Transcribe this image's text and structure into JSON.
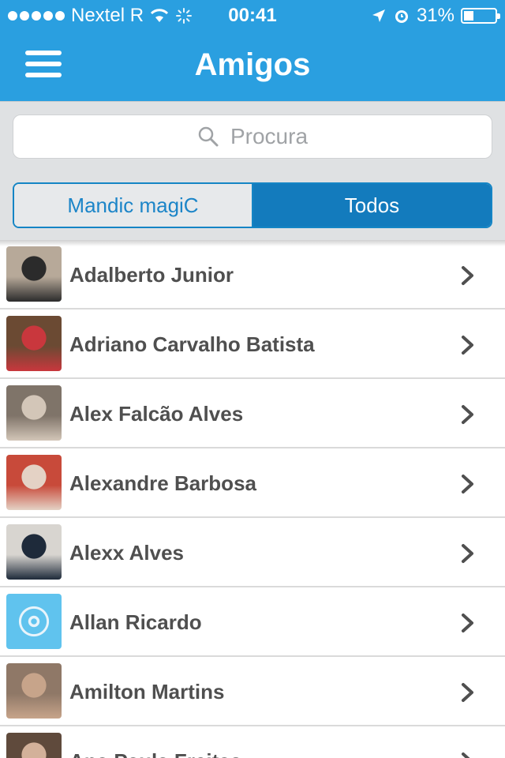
{
  "status_bar": {
    "carrier": "Nextel R",
    "time": "00:41",
    "battery_text": "31%",
    "battery_level": 0.31
  },
  "header": {
    "title": "Amigos",
    "menu_icon": "hamburger-menu-icon"
  },
  "search": {
    "placeholder": "Procura",
    "icon": "search-icon"
  },
  "segments": [
    {
      "label": "Mandic magiC",
      "selected": false
    },
    {
      "label": "Todos",
      "selected": true
    }
  ],
  "friends": [
    {
      "name": "Adalberto Junior",
      "avatar_colors": [
        "#b7a999",
        "#2b2b2b"
      ]
    },
    {
      "name": "Adriano Carvalho Batista",
      "avatar_colors": [
        "#6b4a33",
        "#c9373d"
      ]
    },
    {
      "name": "Alex Falcão Alves",
      "avatar_colors": [
        "#7f7469",
        "#d3c6b8"
      ]
    },
    {
      "name": "Alexandre Barbosa",
      "avatar_colors": [
        "#c84a3a",
        "#e4d2c5"
      ]
    },
    {
      "name": "Alexx Alves",
      "avatar_colors": [
        "#d8d5d0",
        "#1e2a3a"
      ]
    },
    {
      "name": "Allan Ricardo",
      "avatar_colors": [
        "#60c3ee",
        "#e8f4fb"
      ]
    },
    {
      "name": "Amilton Martins",
      "avatar_colors": [
        "#8f7867",
        "#c7a48a"
      ]
    },
    {
      "name": "Ana Paula Freitas",
      "avatar_colors": [
        "#5f4a3c",
        "#d3b19a"
      ]
    }
  ],
  "colors": {
    "accent": "#2a9fe0",
    "segment_selected": "#137bbd"
  }
}
